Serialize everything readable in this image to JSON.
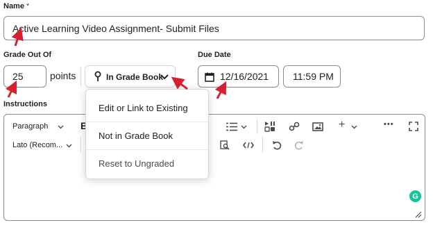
{
  "form": {
    "name_label": "Name",
    "name_required_mark": "*",
    "name_value": "Active Learning Video Assignment- Submit Files",
    "grade_label": "Grade Out Of",
    "grade_value": "25",
    "points_label": "points",
    "gradebook_button_label": "In Grade Book",
    "due_date_label": "Due Date",
    "due_date_value": "12/16/2021",
    "due_time_value": "11:59 PM",
    "instructions_label": "Instructions"
  },
  "gradebook_menu": {
    "items": [
      "Edit or Link to Existing",
      "Not in Grade Book",
      "Reset to Ungraded"
    ]
  },
  "editor": {
    "format_select": "Paragraph",
    "font_select": "Lato (Recom...",
    "more_icon": "•••",
    "icons": [
      "bold-icon",
      "list-icon",
      "insert-stuff-icon",
      "link-icon",
      "image-icon",
      "add-icon",
      "more-icon",
      "fullscreen-icon",
      "find-replace-icon",
      "source-code-icon",
      "undo-icon",
      "redo-icon",
      "grammarly-icon",
      "resize-handle-icon"
    ]
  },
  "annotation_color": "#d6202f"
}
